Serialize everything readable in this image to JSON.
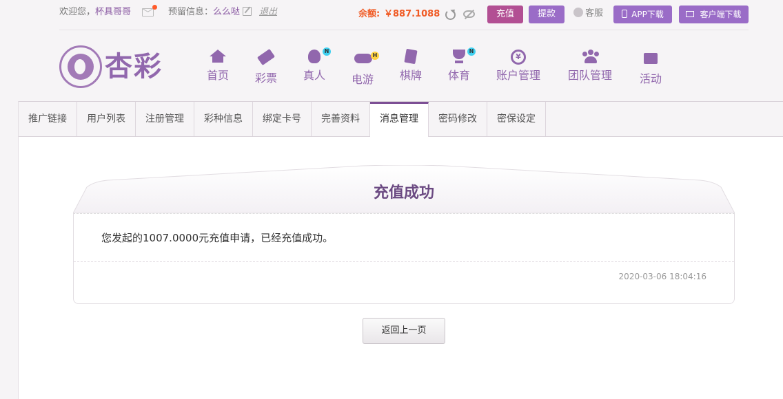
{
  "header": {
    "welcome": "欢迎您，",
    "username": "杯具哥哥",
    "reserve_label": "预留信息：",
    "reserve_value": "么么哒",
    "logout": "退出",
    "balance_label": "余额:",
    "balance_value": "￥887.1088",
    "recharge": "充值",
    "withdraw": "提款",
    "customer_service": "客服",
    "app_download": "APP下载",
    "client_download": "客户端下载"
  },
  "logo_text": "杏彩",
  "nav": [
    {
      "label": "首页",
      "icon": "home-icon"
    },
    {
      "label": "彩票",
      "icon": "ticket-icon"
    },
    {
      "label": "真人",
      "icon": "live-dealer-icon",
      "badge": "N"
    },
    {
      "label": "电游",
      "icon": "gamepad-icon",
      "badge": "H"
    },
    {
      "label": "棋牌",
      "icon": "cards-icon"
    },
    {
      "label": "体育",
      "icon": "trophy-icon",
      "badge": "N"
    },
    {
      "label": "账户管理",
      "icon": "coin-icon",
      "glyph": "¥"
    },
    {
      "label": "团队管理",
      "icon": "team-icon"
    },
    {
      "label": "活动",
      "icon": "gift-icon"
    }
  ],
  "tabs": [
    {
      "label": "推广链接"
    },
    {
      "label": "用户列表"
    },
    {
      "label": "注册管理"
    },
    {
      "label": "彩种信息"
    },
    {
      "label": "绑定卡号"
    },
    {
      "label": "完善资料"
    },
    {
      "label": "消息管理",
      "active": true
    },
    {
      "label": "密码修改"
    },
    {
      "label": "密保设定"
    }
  ],
  "message": {
    "title": "充值成功",
    "body": "您发起的1007.0000元充值申请，已经充值成功。",
    "time": "2020-03-06 18:04:16"
  },
  "back_button": "返回上一页",
  "colors": {
    "brand": "#9167ad",
    "balance": "#f05a24",
    "recharge_button": "#b24f93",
    "secondary_button": "#9a6cc7",
    "active_tab": "#7d4f95"
  }
}
